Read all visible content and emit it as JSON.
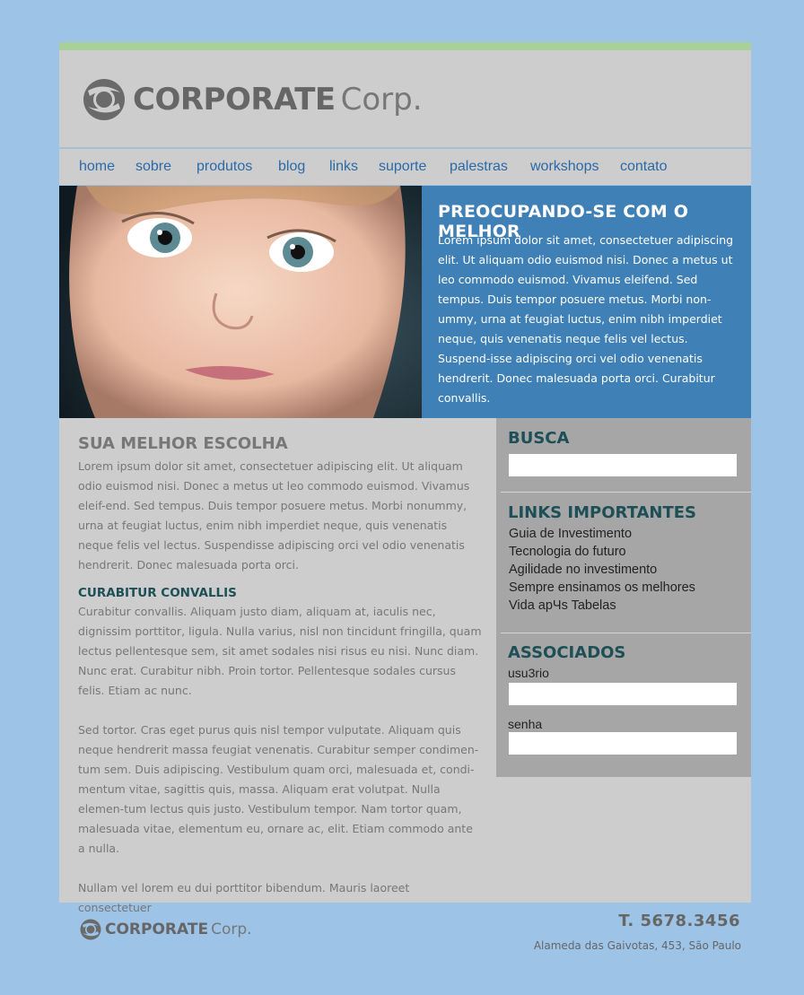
{
  "brand": {
    "word": "CORPORATE",
    "suffix": "Corp."
  },
  "nav": [
    "home",
    "sobre",
    "produtos",
    "blog",
    "links",
    "suporte",
    "palestras",
    "workshops",
    "contato"
  ],
  "hero": {
    "title": "PREOCUPANDO-SE COM O MELHOR",
    "body": "Lorem ipsum dolor sit amet, consectetuer adipiscing elit. Ut aliquam odio euismod nisi. Donec a metus ut leo commodo euismod. Vivamus eleifend. Sed tempus. Duis tempor posuere metus. Morbi non-ummy, urna at feugiat luctus, enim nibh imperdiet neque, quis venenatis neque felis vel lectus. Suspend-isse adipiscing orci vel odio venenatis hendrerit. Donec malesuada porta orci. Curabitur convallis."
  },
  "main": {
    "title": "SUA MELHOR ESCOLHA",
    "p1": "Lorem ipsum dolor sit amet, consectetuer adipiscing elit. Ut aliquam odio euismod nisi. Donec a metus ut leo commodo euismod. Vivamus eleif-end. Sed tempus. Duis tempor posuere metus. Morbi nonummy, urna at feugiat luctus, enim nibh imperdiet neque, quis venenatis neque felis vel lectus. Suspendisse adipiscing orci vel odio venenatis hendrerit. Donec malesuada porta orci.",
    "subtitle": "CURABITUR CONVALLIS",
    "p2": "Curabitur convallis. Aliquam justo diam, aliquam at, iaculis nec, dignissim porttitor, ligula. Nulla varius, nisl non tincidunt fringilla, quam lectus pellentesque sem, sit amet sodales nisi risus eu nisi. Nunc diam. Nunc erat. Curabitur nibh. Proin tortor. Pellentesque sodales cursus felis. Etiam ac nunc.",
    "p3": "Sed tortor. Cras eget purus quis nisl tempor vulputate. Aliquam quis neque hendrerit massa feugiat venenatis. Curabitur semper condimen-tum sem. Duis adipiscing. Vestibulum quam orci, malesuada et, condi-mentum vitae, sagittis quis, massa. Aliquam erat volutpat. Nulla elemen-tum lectus quis justo. Vestibulum tempor. Nam tortor quam, malesuada vitae, elementum eu, ornare ac, elit. Etiam commodo ante a nulla.",
    "p4": "Nullam vel lorem eu dui porttitor bibendum. Mauris laoreet consectetuer"
  },
  "sidebar": {
    "search_title": "BUSCA",
    "links_title": "LINKS IMPORTANTES",
    "links": [
      "Guia de Investimento",
      "Tecnologia do futuro",
      "Agilidade no investimento",
      "Sempre ensinamos os melhores",
      "Vida apЧs Tabelas"
    ],
    "assoc_title": "ASSOCIADOS",
    "user_label": "usu3rio",
    "pass_label": "senha"
  },
  "footer": {
    "phone": "T. 5678.3456",
    "address": "Alameda das Gaivotas, 453, São Paulo"
  }
}
